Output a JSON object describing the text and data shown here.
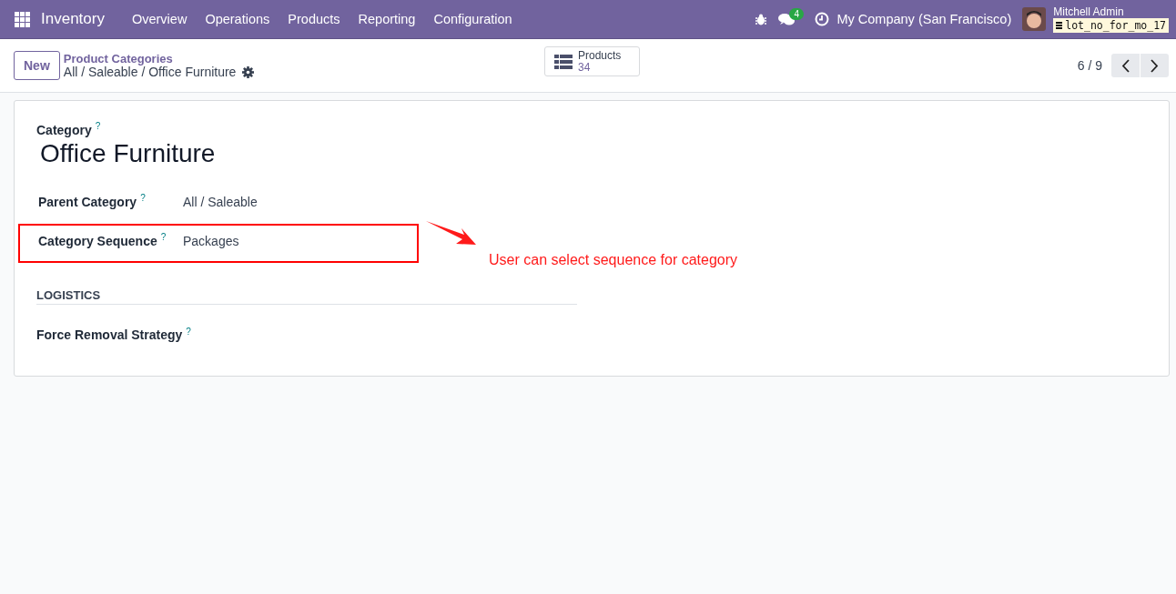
{
  "navbar": {
    "app_name": "Inventory",
    "menu": [
      {
        "label": "Overview"
      },
      {
        "label": "Operations"
      },
      {
        "label": "Products"
      },
      {
        "label": "Reporting"
      },
      {
        "label": "Configuration"
      }
    ],
    "message_count": "4",
    "company": "My Company (San Francisco)",
    "user": "Mitchell Admin",
    "database": "lot_no_for_mo_17"
  },
  "control_panel": {
    "new_button": "New",
    "breadcrumb_parent": "Product Categories",
    "record_path": "All / Saleable / Office Furniture",
    "smart_button": {
      "label": "Products",
      "count": "34"
    },
    "pager": "6 / 9"
  },
  "form": {
    "category_label": "Category",
    "category_help": "?",
    "category_name": "Office Furniture",
    "fields": [
      {
        "label": "Parent Category",
        "help": "?",
        "value": "All / Saleable",
        "highlighted": false
      },
      {
        "label": "Category Sequence",
        "help": "?",
        "value": "Packages",
        "highlighted": true
      }
    ],
    "section": {
      "title": "LOGISTICS",
      "fields": [
        {
          "label": "Force Removal Strategy",
          "help": "?"
        }
      ]
    },
    "annotation": "User can select sequence for category"
  }
}
